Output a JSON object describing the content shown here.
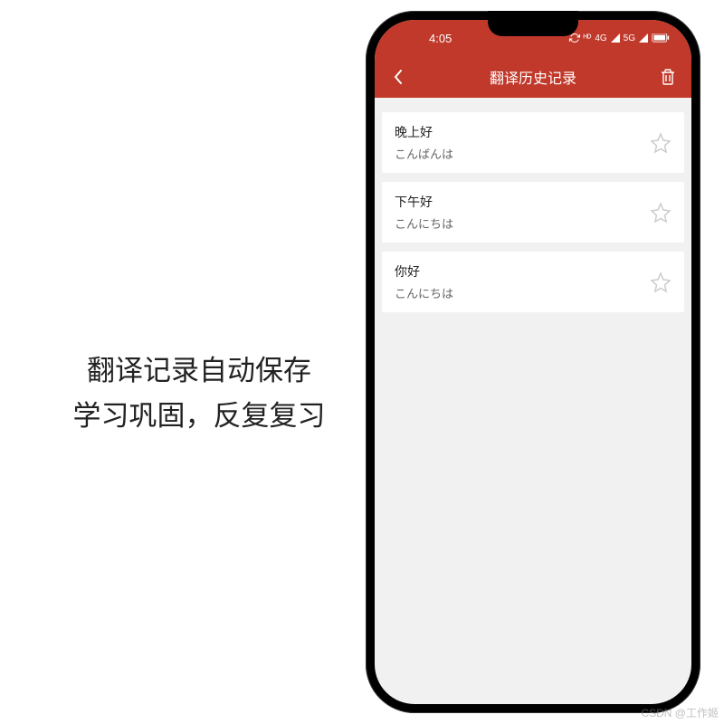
{
  "caption": {
    "line1": "翻译记录自动保存",
    "line2": "学习巩固，反复复习"
  },
  "status": {
    "time": "4:05",
    "indicators": "⟳ ᶻᵢ ⁴ᴳ ⊿ ⁵ᴳ ⊿ 🔋"
  },
  "appbar": {
    "title": "翻译历史记录"
  },
  "history": [
    {
      "src": "晚上好",
      "dst": "こんばんは"
    },
    {
      "src": "下午好",
      "dst": "こんにちは"
    },
    {
      "src": "你好",
      "dst": "こんにちは"
    }
  ],
  "watermark": "CSDN @工作姬",
  "colors": {
    "accent": "#c0392b",
    "bg": "#f1f1f1",
    "card": "#ffffff"
  }
}
